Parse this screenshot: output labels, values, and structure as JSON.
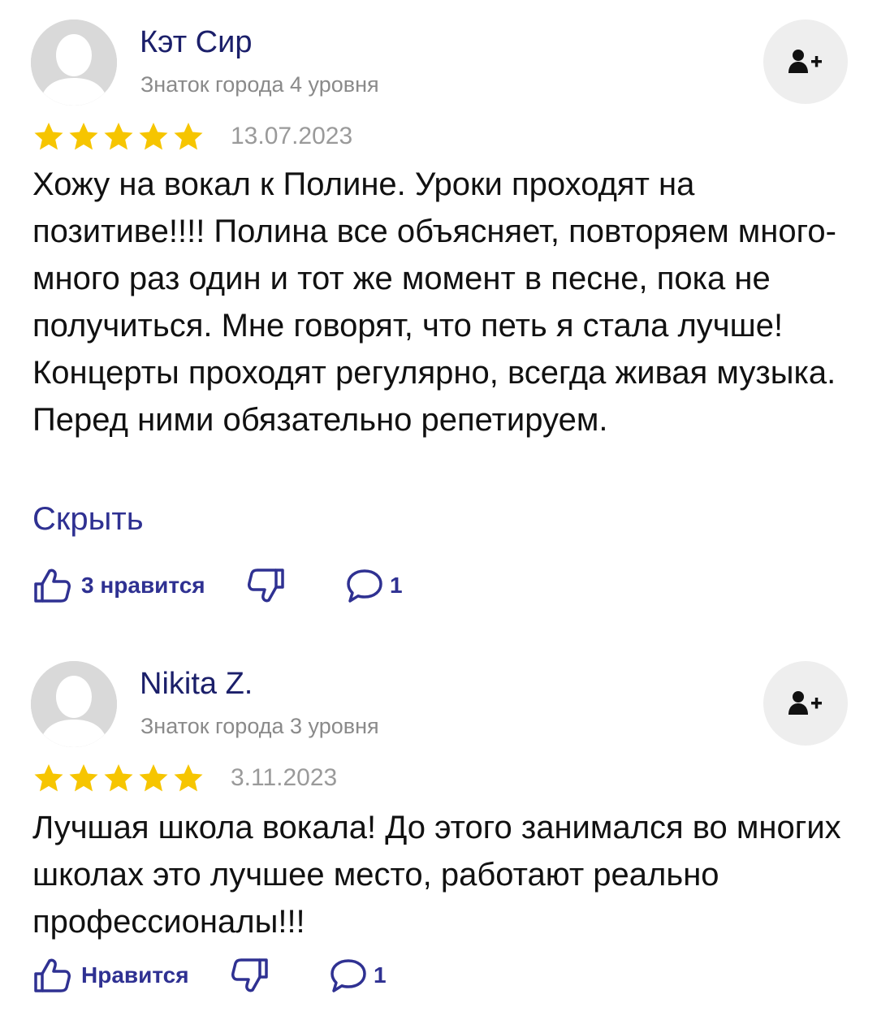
{
  "colors": {
    "name": "#1b1f6a",
    "link": "#2f3192",
    "star": "#f6c500",
    "muted": "#8a8a8a"
  },
  "reviews": [
    {
      "author": "Кэт Сир",
      "level": "Знаток города 4 уровня",
      "rating": 5,
      "date": "13.07.2023",
      "text": "Хожу на вокал к Полине. Уроки проходят на позитиве!!!! Полина все объясняет, повторяем много-много раз один и тот же момент в песне, пока не получиться. Мне говорят, что петь я стала лучше! Концерты проходят регулярно, всегда живая музыка. Перед ними обязательно репетируем.",
      "collapse_label": "Скрыть",
      "like_label": "3 нравится",
      "comment_count": "1"
    },
    {
      "author": "Nikita Z.",
      "level": "Знаток города 3 уровня",
      "rating": 5,
      "date": "3.11.2023",
      "text": "Лучшая школа вокала! До этого занимался во многих школах это лучшее место, работают реально профессионалы!!!",
      "like_label": "Нравится",
      "comment_count": "1"
    }
  ]
}
